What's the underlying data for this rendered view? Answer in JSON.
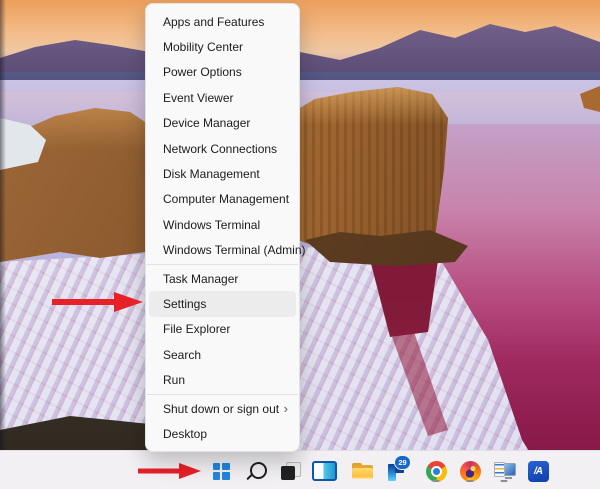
{
  "context_menu": {
    "groups": [
      {
        "items": [
          "Apps and Features",
          "Mobility Center",
          "Power Options",
          "Event Viewer",
          "Device Manager",
          "Network Connections",
          "Disk Management",
          "Computer Management",
          "Windows Terminal",
          "Windows Terminal (Admin)"
        ]
      },
      {
        "items": [
          "Task Manager",
          "Settings",
          "File Explorer",
          "Search",
          "Run"
        ]
      },
      {
        "items": [
          "Shut down or sign out",
          "Desktop"
        ]
      }
    ],
    "highlighted_item": "Settings",
    "submenu_glyph": "›"
  },
  "taskbar": {
    "icons": [
      {
        "name": "start-button",
        "icon": "windows-logo-icon"
      },
      {
        "name": "search-button",
        "icon": "search-icon"
      },
      {
        "name": "task-view-button",
        "icon": "task-view-icon"
      },
      {
        "name": "widgets-button",
        "icon": "widgets-icon"
      },
      {
        "name": "file-explorer-button",
        "icon": "folder-icon"
      },
      {
        "name": "pinned-app-badge-button",
        "icon": "flag-app-icon",
        "badge": "29"
      },
      {
        "name": "chrome-button",
        "icon": "chrome-icon",
        "running": true
      },
      {
        "name": "firefox-button",
        "icon": "firefox-icon",
        "running": true
      },
      {
        "name": "system-config-button",
        "icon": "system-utility-icon",
        "running": true
      },
      {
        "name": "blue-app-button",
        "icon": "slash-a-app-icon",
        "glyph": "/A"
      }
    ]
  },
  "annotations": {
    "settings_arrow": {
      "points_to": "Settings",
      "color": "#e62129"
    },
    "start_arrow": {
      "points_to": "Start button",
      "color": "#e62129"
    }
  },
  "colors": {
    "menu_background": "#f9f9f9",
    "menu_highlight": "#ececec",
    "taskbar_background": "#f2f0f3",
    "start_logo_blue": "#2385dd",
    "annotation_red": "#e62129"
  }
}
